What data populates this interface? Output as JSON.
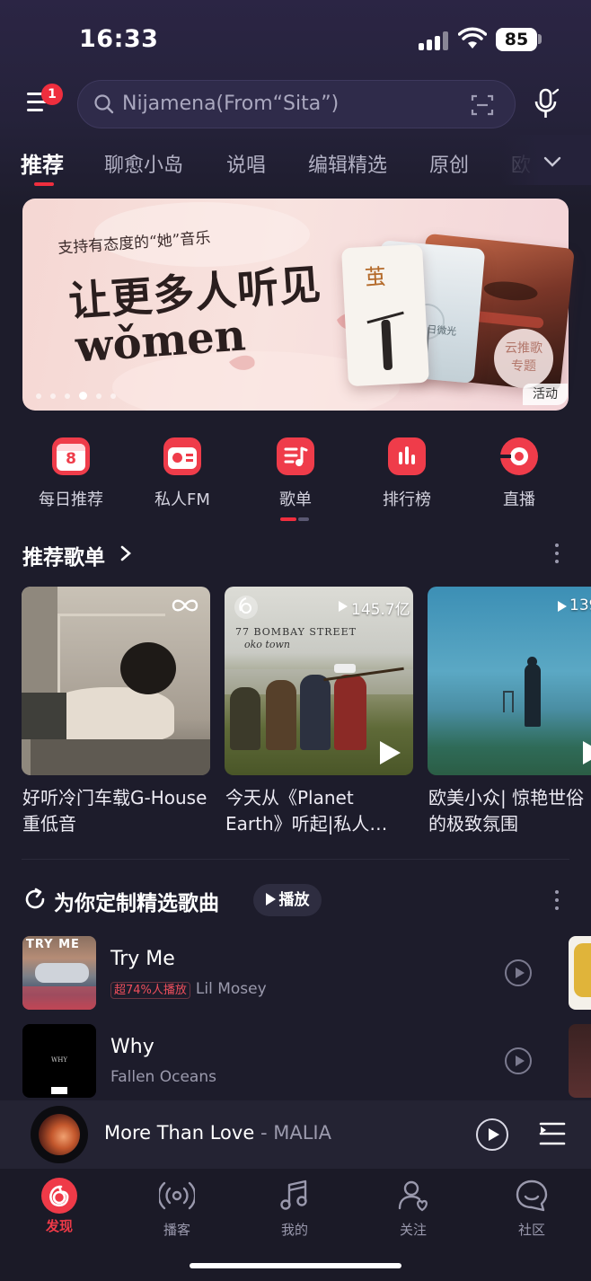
{
  "status_bar": {
    "time": "16:33",
    "battery": "85"
  },
  "header": {
    "menu_badge": "1",
    "search_text": "Nijamena(From“Sita”)"
  },
  "tabs": [
    {
      "label": "推荐",
      "active": true
    },
    {
      "label": "聊愈小岛"
    },
    {
      "label": "说唱"
    },
    {
      "label": "编辑精选"
    },
    {
      "label": "原创"
    },
    {
      "label": "欧"
    }
  ],
  "banner": {
    "subtitle": "支持有态度的“她”音乐",
    "title_line1": "让更多人听见",
    "title_line2": "wǒmen",
    "card_text_1": "茧",
    "card_text_2": "冬日微光",
    "seal_line1": "云推歌",
    "seal_line2": "专题",
    "tag": "活动"
  },
  "quick_entries": [
    {
      "label": "每日推荐",
      "icon": "calendar-icon",
      "day": "8"
    },
    {
      "label": "私人FM",
      "icon": "radio-icon"
    },
    {
      "label": "歌单",
      "icon": "playlist-icon"
    },
    {
      "label": "排行榜",
      "icon": "chart-icon"
    },
    {
      "label": "直播",
      "icon": "live-icon"
    }
  ],
  "recommended_playlists": {
    "title": "推荐歌单",
    "items": [
      {
        "name": "好听冷门车载G-House重低音",
        "count": ""
      },
      {
        "name": "今天从《Planet Earth》听起|私人…",
        "count": "145.7亿",
        "cover_text_1": "77 BOMBAY STREET",
        "cover_text_2": "oko town"
      },
      {
        "name": "欧美小众| 惊艳世俗的极致氛围",
        "count": "139"
      }
    ]
  },
  "custom_songs": {
    "title": "为你定制精选歌曲",
    "play_label": "播放",
    "songs": [
      {
        "title": "Try Me",
        "hot_tag": "超74%人播放",
        "artist": "Lil Mosey",
        "cover_text": "TRY ME"
      },
      {
        "title": "Why",
        "hot_tag": "",
        "artist": "Fallen Oceans",
        "cover_text": "WHY"
      }
    ]
  },
  "now_playing": {
    "title": "More Than Love",
    "separator": " - ",
    "artist": "MALIA"
  },
  "bottom_nav": [
    {
      "label": "发现",
      "icon": "netease-logo-icon",
      "active": true
    },
    {
      "label": "播客",
      "icon": "podcast-icon"
    },
    {
      "label": "我的",
      "icon": "music-note-icon"
    },
    {
      "label": "关注",
      "icon": "follow-user-icon"
    },
    {
      "label": "社区",
      "icon": "community-icon"
    }
  ],
  "colors": {
    "accent": "#ef2e3e",
    "background": "#1d1c2b"
  }
}
